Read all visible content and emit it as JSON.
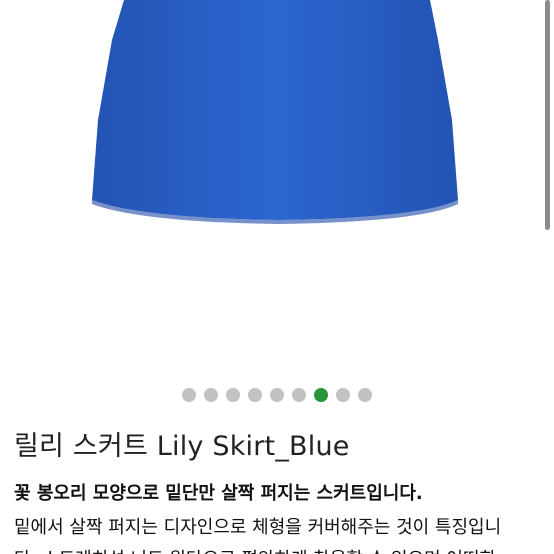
{
  "product": {
    "image_alt": "blue skirt",
    "skirt_color": "#2a62c9",
    "title": "릴리 스커트 Lily Skirt_Blue",
    "headline": "꽃 봉오리 모양으로 밑단만 살짝 퍼지는 스커트입니다.",
    "description_lines": [
      "밑에서 살짝 퍼지는 디자인으로 체형을 커버해주는 것이 특징입니",
      "다. 스트레치성 니트 원단으로 편안하게 착용할 수 있으며 어떠한"
    ]
  },
  "carousel": {
    "total": 9,
    "active_index": 6,
    "dot_color": "#c2c2c2",
    "active_color": "#27963a"
  }
}
